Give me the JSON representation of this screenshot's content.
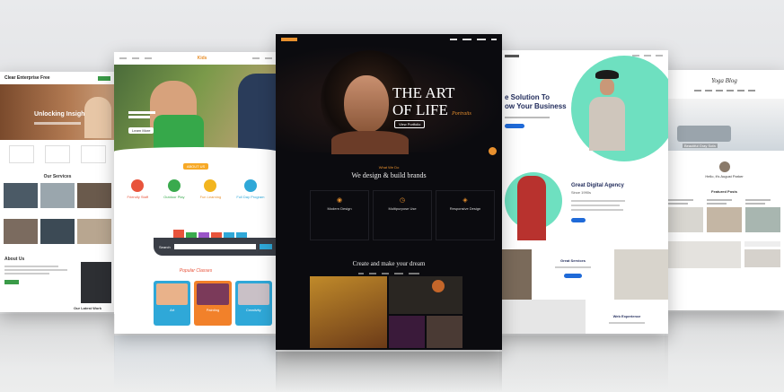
{
  "left_site": {
    "title": "Clear Enterprise Free",
    "hero": "Unlocking Insights",
    "services_title": "Our Services",
    "about_title": "About Us",
    "latest_title": "Our Latest Work"
  },
  "kids_site": {
    "logo": "Kids",
    "hero_btn": "Learn More",
    "about_tag": "ABOUT US",
    "features": [
      "Friendly Staff",
      "Outdoor Play",
      "Fun Learning",
      "Full Day Program"
    ],
    "search_label": "Search",
    "classes_title": "Popular Classes",
    "class_labels": [
      "Art",
      "Painting",
      "Creativity"
    ]
  },
  "dark_site": {
    "hero_line1": "THE ART",
    "hero_line2": "OF LIFE",
    "hero_script": "Portraits",
    "hero_btn": "View Portfolio",
    "tag": "What We Do",
    "heading": "We design & build brands",
    "services": [
      "Modern Design",
      "Multipurpose Use",
      "Responsive Design"
    ],
    "gallery_heading": "Create and make your dream"
  },
  "agency_site": {
    "hero_line1": "e Solution To",
    "hero_line2": "ow Your Business",
    "agency_title": "Great Digital Agency",
    "agency_sub": "Since 1990s",
    "services_label": "Great Services",
    "experience_label": "Web Experience"
  },
  "blog_site": {
    "title": "Yoga Blog",
    "featured": "Featured Posts",
    "caption": "Beautiful Gray Sofa",
    "author": "Hello, it's August Parker"
  }
}
